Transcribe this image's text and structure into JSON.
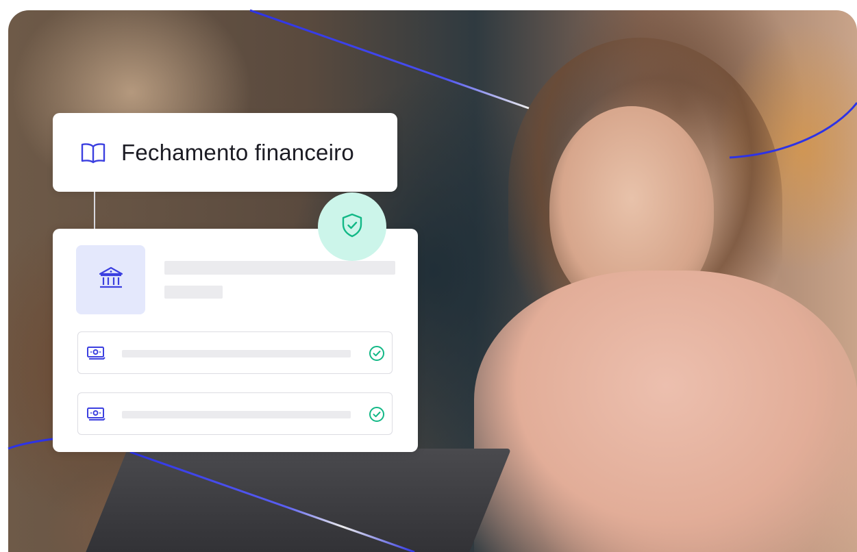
{
  "hero": {
    "title": "Fechamento financeiro",
    "icon": "book-open-icon"
  },
  "card": {
    "header_icon": "bank-icon",
    "shield_icon": "shield-check-icon",
    "rows": [
      {
        "icon": "money-icon",
        "status_icon": "check-circle-icon"
      },
      {
        "icon": "money-icon",
        "status_icon": "check-circle-icon"
      }
    ]
  },
  "colors": {
    "accent": "#3b3fe0",
    "success": "#12b886",
    "success_bg": "#ccf5ea",
    "bank_tile_bg": "#e4e8fc"
  }
}
